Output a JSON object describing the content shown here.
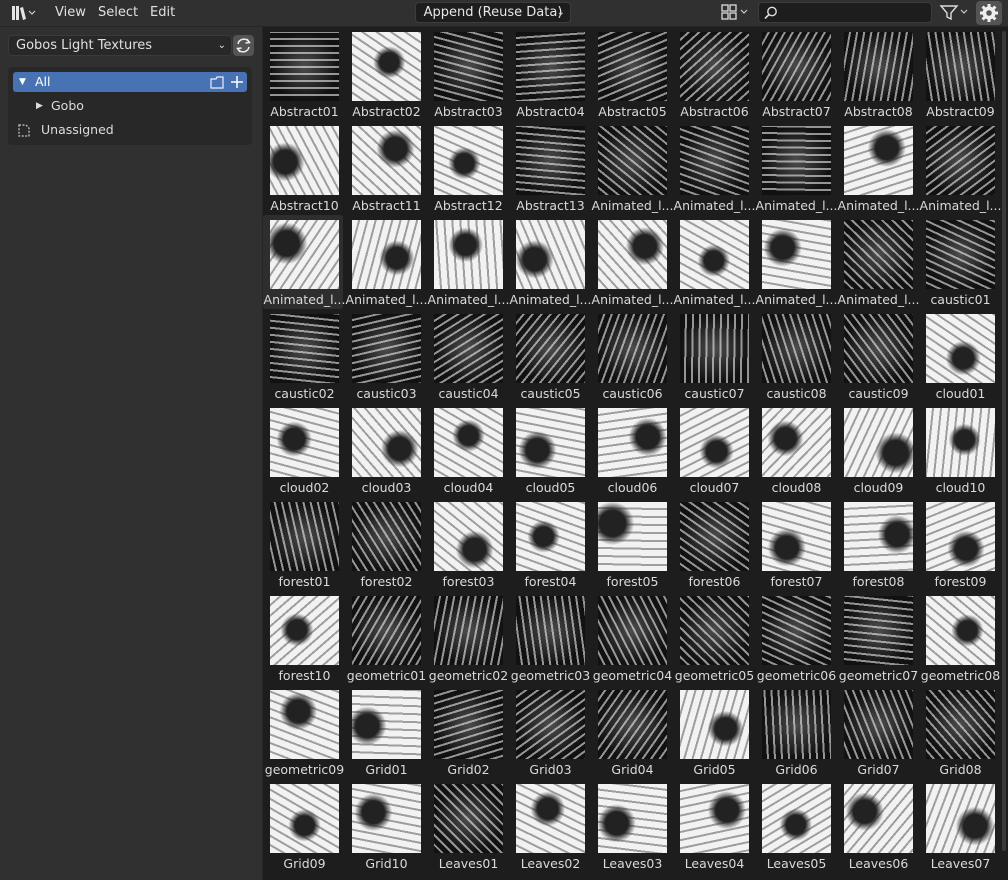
{
  "header": {
    "menu": [
      "View",
      "Select",
      "Edit"
    ],
    "import_method": "Append (Reuse Data)",
    "search": {
      "value": "",
      "placeholder": ""
    }
  },
  "sidebar": {
    "library": "Gobos Light Textures",
    "catalog": [
      {
        "label": "All",
        "active": true,
        "icon": "triangle-down-icon"
      },
      {
        "label": "Gobo",
        "active": false,
        "icon": "triangle-right-icon"
      },
      {
        "label": "Unassigned",
        "active": false,
        "icon": "unassigned-icon"
      }
    ]
  },
  "assets": [
    [
      "Abstract01",
      "dark"
    ],
    [
      "Abstract02",
      "light"
    ],
    [
      "Abstract03",
      "dark"
    ],
    [
      "Abstract04",
      "dark"
    ],
    [
      "Abstract05",
      "dark"
    ],
    [
      "Abstract06",
      "dark"
    ],
    [
      "Abstract07",
      "dark"
    ],
    [
      "Abstract08",
      "dark"
    ],
    [
      "Abstract09",
      "dark"
    ],
    [
      "Abstract10",
      "light"
    ],
    [
      "Abstract11",
      "light"
    ],
    [
      "Abstract12",
      "light"
    ],
    [
      "Abstract13",
      "dark"
    ],
    [
      "Animated_l...",
      "dark"
    ],
    [
      "Animated_l...",
      "dark"
    ],
    [
      "Animated_l...",
      "dark"
    ],
    [
      "Animated_l...",
      "light"
    ],
    [
      "Animated_l...",
      "dark"
    ],
    [
      "Animated_l...",
      "light"
    ],
    [
      "Animated_l...",
      "light"
    ],
    [
      "Animated_l...",
      "light"
    ],
    [
      "Animated_l...",
      "light"
    ],
    [
      "Animated_l...",
      "light"
    ],
    [
      "Animated_l...",
      "light"
    ],
    [
      "Animated_l...",
      "light"
    ],
    [
      "Animated_l...",
      "dark"
    ],
    [
      "caustic01",
      "dark"
    ],
    [
      "caustic02",
      "dark"
    ],
    [
      "caustic03",
      "dark"
    ],
    [
      "caustic04",
      "dark"
    ],
    [
      "caustic05",
      "dark"
    ],
    [
      "caustic06",
      "dark"
    ],
    [
      "caustic07",
      "dark"
    ],
    [
      "caustic08",
      "dark"
    ],
    [
      "caustic09",
      "dark"
    ],
    [
      "cloud01",
      "light"
    ],
    [
      "cloud02",
      "light"
    ],
    [
      "cloud03",
      "light"
    ],
    [
      "cloud04",
      "light"
    ],
    [
      "cloud05",
      "light"
    ],
    [
      "cloud06",
      "light"
    ],
    [
      "cloud07",
      "light"
    ],
    [
      "cloud08",
      "light"
    ],
    [
      "cloud09",
      "light"
    ],
    [
      "cloud10",
      "light"
    ],
    [
      "forest01",
      "dark"
    ],
    [
      "forest02",
      "dark"
    ],
    [
      "forest03",
      "light"
    ],
    [
      "forest04",
      "light"
    ],
    [
      "forest05",
      "light"
    ],
    [
      "forest06",
      "dark"
    ],
    [
      "forest07",
      "light"
    ],
    [
      "forest08",
      "light"
    ],
    [
      "forest09",
      "light"
    ],
    [
      "forest10",
      "light"
    ],
    [
      "geometric01",
      "dark"
    ],
    [
      "geometric02",
      "dark"
    ],
    [
      "geometric03",
      "dark"
    ],
    [
      "geometric04",
      "dark"
    ],
    [
      "geometric05",
      "dark"
    ],
    [
      "geometric06",
      "dark"
    ],
    [
      "geometric07",
      "dark"
    ],
    [
      "geometric08",
      "light"
    ],
    [
      "geometric09",
      "light"
    ],
    [
      "Grid01",
      "light"
    ],
    [
      "Grid02",
      "dark"
    ],
    [
      "Grid03",
      "dark"
    ],
    [
      "Grid04",
      "dark"
    ],
    [
      "Grid05",
      "light"
    ],
    [
      "Grid06",
      "dark"
    ],
    [
      "Grid07",
      "dark"
    ],
    [
      "Grid08",
      "dark"
    ],
    [
      "Grid09",
      "light"
    ],
    [
      "Grid10",
      "light"
    ],
    [
      "Leaves01",
      "dark"
    ],
    [
      "Leaves02",
      "light"
    ],
    [
      "Leaves03",
      "light"
    ],
    [
      "Leaves04",
      "light"
    ],
    [
      "Leaves05",
      "light"
    ],
    [
      "Leaves06",
      "light"
    ],
    [
      "Leaves07",
      "light"
    ]
  ],
  "colors": {
    "accent": "#4772b3",
    "background": "#1d1d1d"
  }
}
